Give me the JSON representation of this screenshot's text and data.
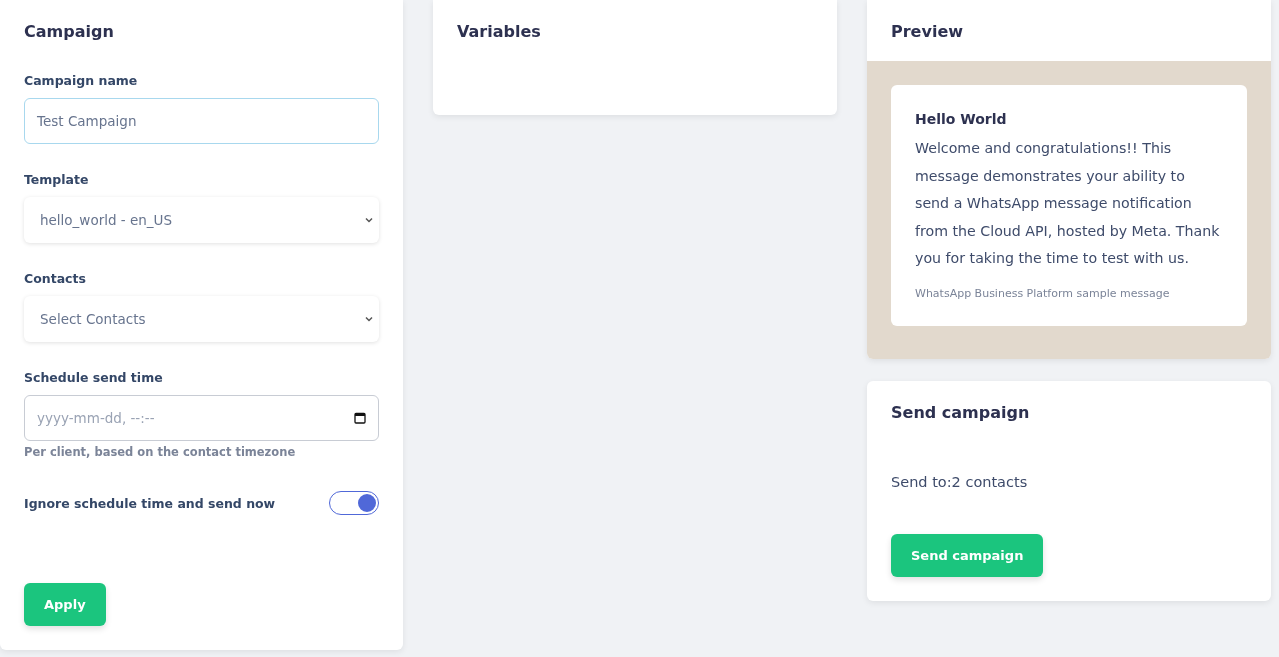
{
  "campaign": {
    "title": "Campaign",
    "name_field": {
      "label": "Campaign name",
      "value": "Test Campaign"
    },
    "template_field": {
      "label": "Template",
      "value": "hello_world - en_US"
    },
    "contacts_field": {
      "label": "Contacts",
      "placeholder": "Select Contacts"
    },
    "schedule_field": {
      "label": "Schedule send time",
      "placeholder": "yyyy-mm-dd, --:--",
      "help": "Per client, based on the contact timezone"
    },
    "ignore_schedule": {
      "label": "Ignore schedule time and send now",
      "on": true
    },
    "apply_button": "Apply"
  },
  "variables": {
    "title": "Variables"
  },
  "preview": {
    "title": "Preview",
    "message": {
      "header": "Hello World",
      "body": "Welcome and congratulations!! This message demonstrates your ability to send a WhatsApp message notification from the Cloud API, hosted by Meta. Thank you for taking the time to test with us.",
      "footer": "WhatsApp Business Platform sample message"
    }
  },
  "send": {
    "title": "Send campaign",
    "summary": "Send to:2 contacts",
    "button": "Send campaign"
  }
}
